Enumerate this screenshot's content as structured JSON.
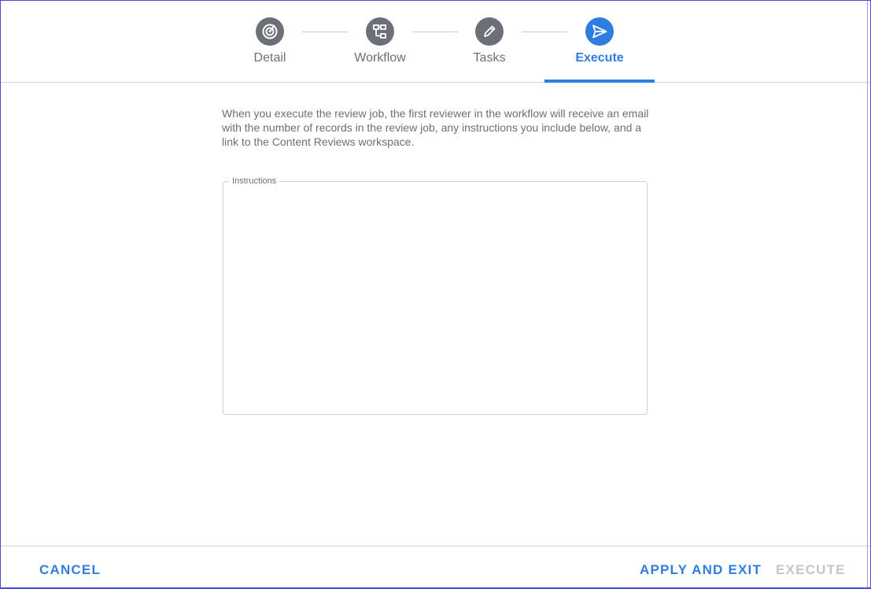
{
  "stepper": {
    "steps": [
      {
        "label": "Detail",
        "icon": "target-icon",
        "active": false
      },
      {
        "label": "Workflow",
        "icon": "workflow-icon",
        "active": false
      },
      {
        "label": "Tasks",
        "icon": "pencil-icon",
        "active": false
      },
      {
        "label": "Execute",
        "icon": "send-icon",
        "active": true
      }
    ]
  },
  "main": {
    "intro": "When you execute the review job, the first reviewer in the workflow will receive an email with the number of records in the review job, any instructions you include below, and a link to the Content Reviews workspace.",
    "instructions": {
      "label": "Instructions",
      "value": ""
    }
  },
  "footer": {
    "cancel_label": "CANCEL",
    "apply_label": "APPLY AND EXIT",
    "execute_label": "EXECUTE",
    "execute_enabled": false
  },
  "colors": {
    "accent": "#2f7de1",
    "step_inactive": "#6a6f78",
    "disabled_text": "#c3c6cb",
    "divider": "#d0d2d6"
  }
}
